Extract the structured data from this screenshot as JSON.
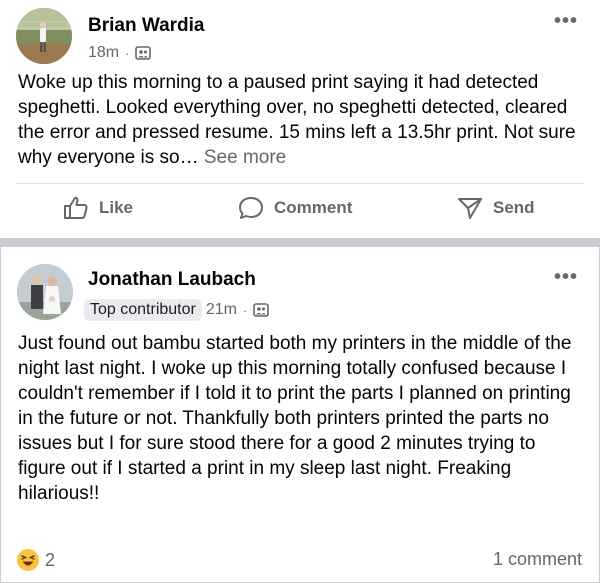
{
  "posts": [
    {
      "author": "Brian Wardia",
      "time": "18m",
      "separator": "·",
      "more": "•••",
      "text": "Woke up this morning to a paused print saying it had detected speghetti. Looked everything over, no speghetti detected, cleared the error and pressed resume. 15 mins left a 13.5hr print. Not sure why everyone is so…",
      "see_more": "See more",
      "actions": {
        "like": "Like",
        "comment": "Comment",
        "send": "Send"
      }
    },
    {
      "author": "Jonathan Laubach",
      "badge": "Top contributor",
      "time": "21m",
      "separator": "·",
      "more": "•••",
      "text": "Just found out bambu started both my printers in the middle of the night last night. I woke up this morning totally confused because I couldn't remember if I told it to print the parts I planned on printing in the future or not. Thankfully both printers printed the parts no issues but I for sure stood there for a good 2 minutes trying to figure out if I started a print in my sleep last night. Freaking hilarious!!",
      "reaction_count": "2",
      "comment_count": "1 comment"
    }
  ],
  "icons": {
    "audience": "group-audience-icon",
    "reaction": "laughing-emoji-icon",
    "like": "thumbs-up-icon",
    "comment": "speech-bubble-icon",
    "send": "send-icon"
  },
  "colors": {
    "meta": "#65676b",
    "text": "#050505",
    "divider": "#c9ccd1",
    "emoji": "#f7c43c"
  }
}
